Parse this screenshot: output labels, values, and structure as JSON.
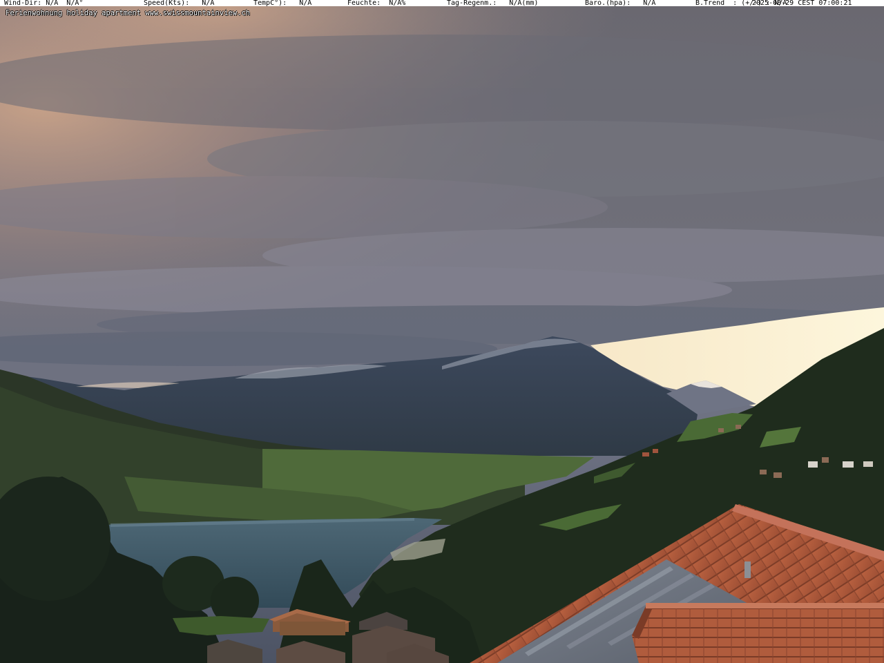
{
  "telemetry": {
    "wind_dir": "Wind-Dir: N/A  N/A°",
    "speed": "Speed(Kts):   N/A",
    "temp": "TempC°):   N/A",
    "humidity": "Feuchte:  N/A%",
    "rain": "Tag-Regenm.:   N/A(mm)",
    "baro": "Baro.(hpa):   N/A",
    "trend": "B.Trend  : (+/-) : N/A",
    "timestamp": "2025-08-29 CEST 07:00:21"
  },
  "caption": "Ferienwohnung holiday apartment www.swissmountainview.ch",
  "scene": {
    "subject": "webcam-view-lake-and-mountains",
    "colors": {
      "sky_top": "#5e5f69",
      "sky_glow": "#e6b48f",
      "clear_sky": "#fdf6dc",
      "lake": "#3f5866",
      "mountain_far": "#3a4558",
      "forest": "#1e2a1c",
      "roof": "#b25a3c",
      "solar_panel": "#6f7683"
    }
  }
}
